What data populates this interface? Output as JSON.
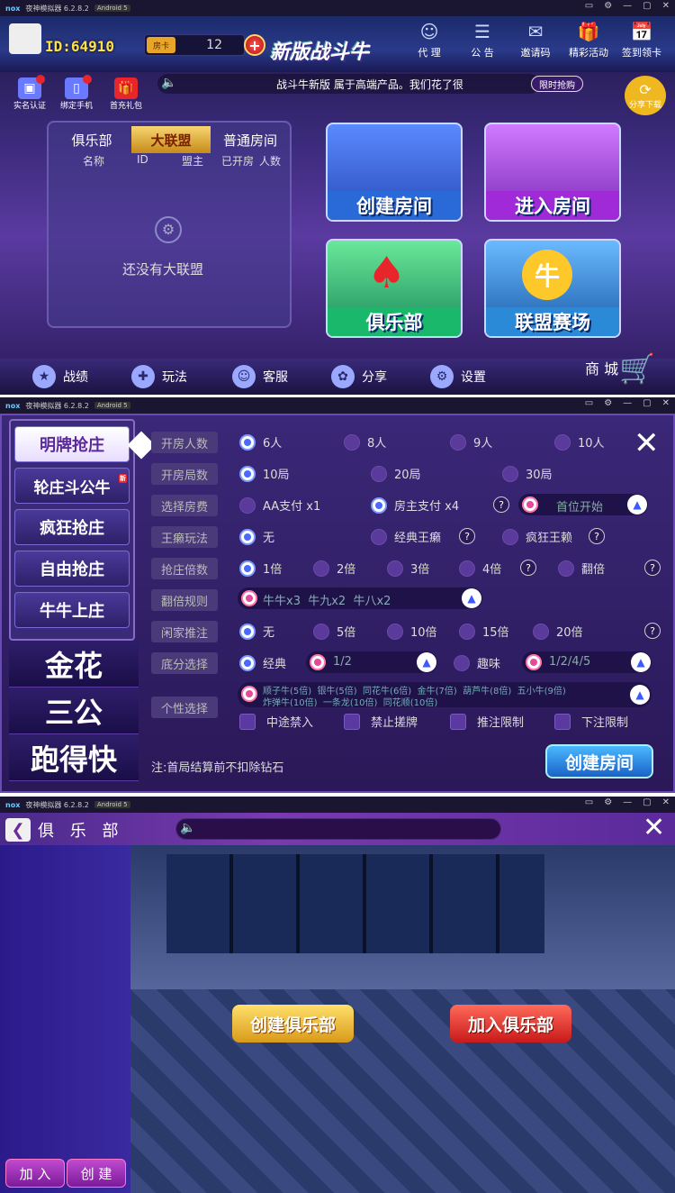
{
  "emulator": {
    "name": "夜神模拟器 6.2.8.2",
    "android": "Android 5",
    "logo": "nox"
  },
  "lobby": {
    "user_id": "ID:64910",
    "room_card_label": "房卡",
    "room_card_count": "12",
    "logo_text": "新版战斗牛",
    "top_icons": [
      {
        "label": "代 理",
        "icon": "agent-icon"
      },
      {
        "label": "公 告",
        "icon": "announcement-icon"
      },
      {
        "label": "邀请码",
        "icon": "invite-icon"
      },
      {
        "label": "精彩活动",
        "icon": "gift-icon"
      },
      {
        "label": "签到领卡",
        "icon": "checkin-icon"
      }
    ],
    "small_buttons": [
      {
        "label": "实名认证",
        "icon": "id-card-icon"
      },
      {
        "label": "绑定手机",
        "icon": "phone-icon"
      },
      {
        "label": "首充礼包",
        "icon": "gift-box-icon"
      }
    ],
    "marquee": "战斗牛新版 属于高端产品。我们花了很",
    "limited_offer": "限时抢购",
    "share_download": "分享下载",
    "tabs": [
      "俱乐部",
      "大联盟",
      "普通房间"
    ],
    "active_tab": "大联盟",
    "table_headers": [
      "名称",
      "ID",
      "盟主",
      "已开房",
      "人数"
    ],
    "empty_text": "还没有大联盟",
    "big_buttons": [
      {
        "label": "创建房间",
        "color": "#2a6ad8"
      },
      {
        "label": "进入房间",
        "color": "#a02ad8"
      },
      {
        "label": "俱乐部",
        "color": "#1ab86a"
      },
      {
        "label": "联盟赛场",
        "color": "#2a8ad8"
      }
    ],
    "bottom_items": [
      {
        "label": "战绩",
        "icon": "star-icon"
      },
      {
        "label": "玩法",
        "icon": "gamepad-icon"
      },
      {
        "label": "客服",
        "icon": "headset-icon"
      },
      {
        "label": "分享",
        "icon": "share-icon"
      },
      {
        "label": "设置",
        "icon": "gear-icon"
      }
    ],
    "shop": "商 城"
  },
  "create_room": {
    "left_nav": [
      "明牌抢庄",
      "轮庄斗公牛",
      "疯狂抢庄",
      "自由抢庄",
      "牛牛上庄"
    ],
    "new_badge": "新",
    "active_mode": "明牌抢庄",
    "big_nav": [
      "金花",
      "三公",
      "跑得快"
    ],
    "rows": {
      "players": {
        "label": "开房人数",
        "options": [
          "6人",
          "8人",
          "9人",
          "10人"
        ],
        "selected": "6人"
      },
      "rounds": {
        "label": "开房局数",
        "options": [
          "10局",
          "20局",
          "30局"
        ],
        "selected": "10局"
      },
      "fee": {
        "label": "选择房费",
        "options": [
          "AA支付 x1",
          "房主支付 x4"
        ],
        "selected": "房主支付 x4",
        "dropdown": "首位开始"
      },
      "wildcard": {
        "label": "王癞玩法",
        "options": [
          "无",
          "经典王癞",
          "疯狂王赖"
        ],
        "selected": "无"
      },
      "grab": {
        "label": "抢庄倍数",
        "options": [
          "1倍",
          "2倍",
          "3倍",
          "4倍",
          "翻倍"
        ],
        "selected": "1倍"
      },
      "multiplier": {
        "label": "翻倍规则",
        "dropdown": "牛牛x3  牛九x2  牛八x2"
      },
      "push": {
        "label": "闲家推注",
        "options": [
          "无",
          "5倍",
          "10倍",
          "15倍",
          "20倍"
        ],
        "selected": "无"
      },
      "base": {
        "label": "底分选择",
        "options": [
          "经典",
          "趣味"
        ],
        "selected": "经典",
        "classic_value": "1/2",
        "fun_value": "1/2/4/5"
      },
      "special": {
        "label": "个性选择",
        "line1": "顺子牛(5倍)  银牛(5倍)  同花牛(6倍)  金牛(7倍)  葫芦牛(8倍)  五小牛(9倍)",
        "line2": "炸弹牛(10倍)  一条龙(10倍)  同花顺(10倍)"
      }
    },
    "checkboxes": [
      "中途禁入",
      "禁止搓牌",
      "推注限制",
      "下注限制"
    ],
    "note": "注:首局结算前不扣除钻石",
    "create_label": "创建房间"
  },
  "club": {
    "title": "俱 乐 部",
    "create_club": "创建俱乐部",
    "join_club": "加入俱乐部",
    "join_small": "加 入",
    "create_small": "创 建"
  }
}
